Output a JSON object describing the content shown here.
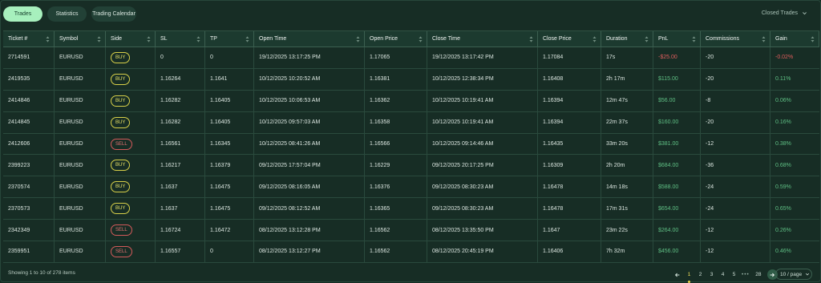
{
  "tabs": [
    {
      "label": "Trades",
      "active": true
    },
    {
      "label": "Statistics",
      "active": false
    },
    {
      "label": "Trading Calendar",
      "active": false
    }
  ],
  "filter": {
    "label": "Closed Trades",
    "icon": "chevron-down-icon"
  },
  "columns": [
    "Ticket #",
    "Symbol",
    "Side",
    "SL",
    "TP",
    "Open Time",
    "Open Price",
    "Close Time",
    "Close Price",
    "Duration",
    "PnL",
    "Commissions",
    "Gain"
  ],
  "rows": [
    {
      "ticket": "2714591",
      "symbol": "EURUSD",
      "side": "BUY",
      "sl": "0",
      "tp": "0",
      "open_time": "19/12/2025 13:17:25 PM",
      "open_price": "1.17065",
      "close_time": "19/12/2025 13:17:42 PM",
      "close_price": "1.17084",
      "duration": "17s",
      "pnl": "-$25.00",
      "commissions": "-20",
      "gain": "-0.02%"
    },
    {
      "ticket": "2419535",
      "symbol": "EURUSD",
      "side": "BUY",
      "sl": "1.16264",
      "tp": "1.1641",
      "open_time": "10/12/2025 10:20:52 AM",
      "open_price": "1.16381",
      "close_time": "10/12/2025 12:38:34 PM",
      "close_price": "1.16408",
      "duration": "2h 17m",
      "pnl": "$115.00",
      "commissions": "-20",
      "gain": "0.11%"
    },
    {
      "ticket": "2414846",
      "symbol": "EURUSD",
      "side": "BUY",
      "sl": "1.16282",
      "tp": "1.16405",
      "open_time": "10/12/2025 10:06:53 AM",
      "open_price": "1.16362",
      "close_time": "10/12/2025 10:19:41 AM",
      "close_price": "1.16394",
      "duration": "12m 47s",
      "pnl": "$56.00",
      "commissions": "-8",
      "gain": "0.06%"
    },
    {
      "ticket": "2414845",
      "symbol": "EURUSD",
      "side": "BUY",
      "sl": "1.16282",
      "tp": "1.16405",
      "open_time": "10/12/2025 09:57:03 AM",
      "open_price": "1.16358",
      "close_time": "10/12/2025 10:19:41 AM",
      "close_price": "1.16394",
      "duration": "22m 37s",
      "pnl": "$160.00",
      "commissions": "-20",
      "gain": "0.16%"
    },
    {
      "ticket": "2412606",
      "symbol": "EURUSD",
      "side": "SELL",
      "sl": "1.16561",
      "tp": "1.16345",
      "open_time": "10/12/2025 08:41:26 AM",
      "open_price": "1.16566",
      "close_time": "10/12/2025 09:14:46 AM",
      "close_price": "1.16435",
      "duration": "33m 20s",
      "pnl": "$381.00",
      "commissions": "-12",
      "gain": "0.38%"
    },
    {
      "ticket": "2399223",
      "symbol": "EURUSD",
      "side": "BUY",
      "sl": "1.16217",
      "tp": "1.16379",
      "open_time": "09/12/2025 17:57:04 PM",
      "open_price": "1.16229",
      "close_time": "09/12/2025 20:17:25 PM",
      "close_price": "1.16309",
      "duration": "2h 20m",
      "pnl": "$684.00",
      "commissions": "-36",
      "gain": "0.68%"
    },
    {
      "ticket": "2370574",
      "symbol": "EURUSD",
      "side": "BUY",
      "sl": "1.1637",
      "tp": "1.16475",
      "open_time": "09/12/2025 08:16:05 AM",
      "open_price": "1.16376",
      "close_time": "09/12/2025 08:30:23 AM",
      "close_price": "1.16478",
      "duration": "14m 18s",
      "pnl": "$588.00",
      "commissions": "-24",
      "gain": "0.59%"
    },
    {
      "ticket": "2370573",
      "symbol": "EURUSD",
      "side": "BUY",
      "sl": "1.1637",
      "tp": "1.16475",
      "open_time": "09/12/2025 08:12:52 AM",
      "open_price": "1.16365",
      "close_time": "09/12/2025 08:30:23 AM",
      "close_price": "1.16478",
      "duration": "17m 31s",
      "pnl": "$654.00",
      "commissions": "-24",
      "gain": "0.65%"
    },
    {
      "ticket": "2342349",
      "symbol": "EURUSD",
      "side": "SELL",
      "sl": "1.16724",
      "tp": "1.16472",
      "open_time": "08/12/2025 13:12:28 PM",
      "open_price": "1.16562",
      "close_time": "08/12/2025 13:35:50 PM",
      "close_price": "1.1647",
      "duration": "23m 22s",
      "pnl": "$264.00",
      "commissions": "-12",
      "gain": "0.26%"
    },
    {
      "ticket": "2359951",
      "symbol": "EURUSD",
      "side": "SELL",
      "sl": "1.16557",
      "tp": "0",
      "open_time": "08/12/2025 13:12:27 PM",
      "open_price": "1.16562",
      "close_time": "08/12/2025 20:45:19 PM",
      "close_price": "1.16406",
      "duration": "7h 32m",
      "pnl": "$456.00",
      "commissions": "-12",
      "gain": "0.46%"
    }
  ],
  "footer": {
    "showing": "Showing 1 to 10 of 278 items",
    "pages": [
      "1",
      "2",
      "3",
      "4",
      "5"
    ],
    "ellipsis": "•••",
    "last_page": "28",
    "current_page": "1",
    "page_size": "10 / page"
  },
  "colors": {
    "accent": "#a7f0bd",
    "negative": "#e05d5d",
    "positive": "#5fbf84",
    "buy": "#d8d049",
    "sell": "#d35a5a"
  }
}
